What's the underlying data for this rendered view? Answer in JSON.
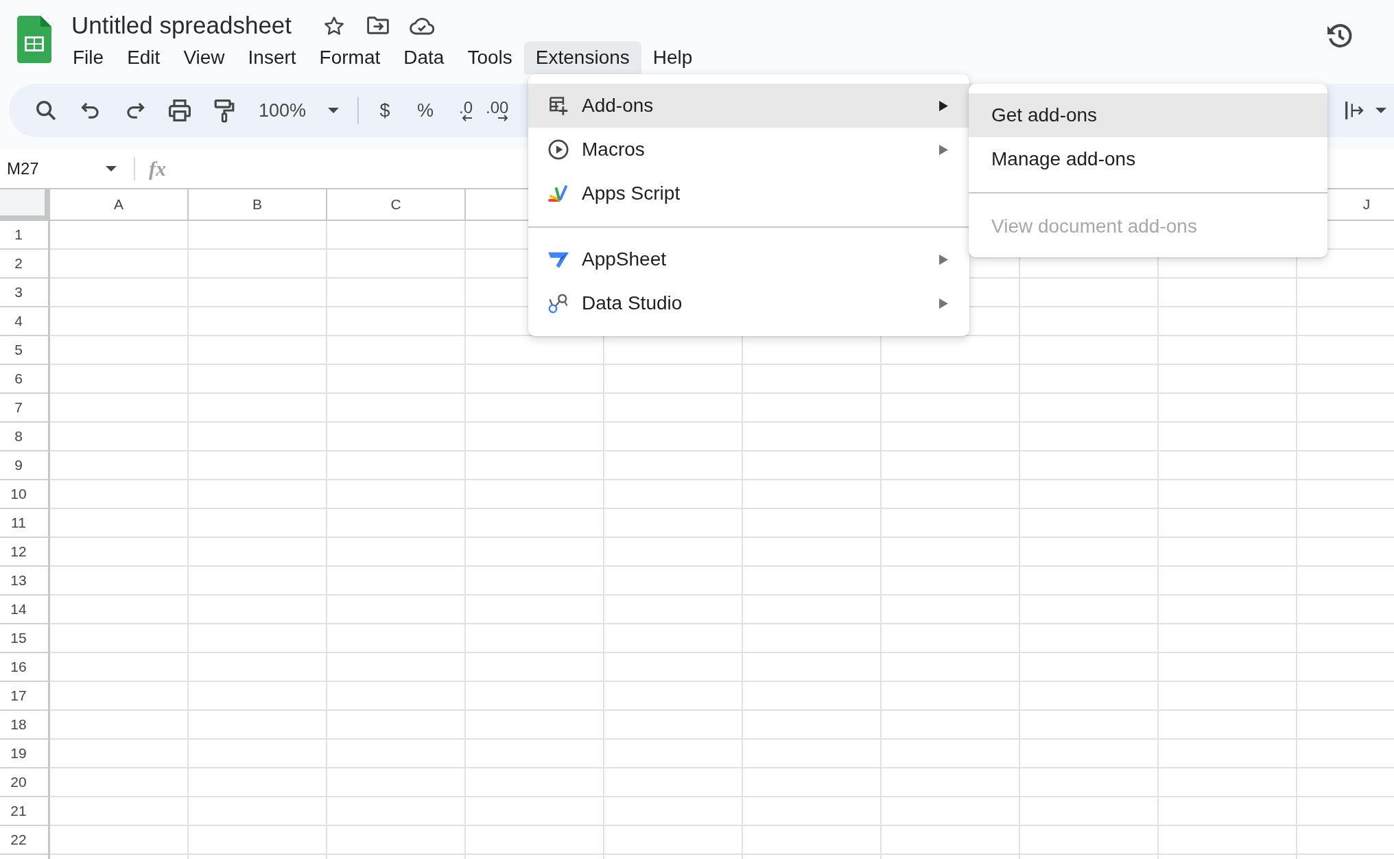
{
  "document": {
    "title": "Untitled spreadsheet"
  },
  "menu_bar": [
    {
      "label": "File",
      "selected": false
    },
    {
      "label": "Edit",
      "selected": false
    },
    {
      "label": "View",
      "selected": false
    },
    {
      "label": "Insert",
      "selected": false
    },
    {
      "label": "Format",
      "selected": false
    },
    {
      "label": "Data",
      "selected": false
    },
    {
      "label": "Tools",
      "selected": false
    },
    {
      "label": "Extensions",
      "selected": true
    },
    {
      "label": "Help",
      "selected": false
    }
  ],
  "toolbar": {
    "zoom": "100%",
    "currency": "$",
    "percent": "%",
    "decrease_decimal": ".0",
    "increase_decimal": ".00"
  },
  "formula_bar": {
    "cell_reference": "M27",
    "function_symbol": "fx"
  },
  "grid": {
    "columns": [
      "A",
      "B",
      "C"
    ],
    "last_column": "J",
    "rows": [
      "1",
      "2",
      "3",
      "4",
      "5",
      "6",
      "7",
      "8",
      "9",
      "10",
      "11",
      "12",
      "13",
      "14",
      "15",
      "16",
      "17",
      "18",
      "19",
      "20",
      "21",
      "22"
    ]
  },
  "extensions_menu": {
    "groups": [
      [
        {
          "label": "Add-ons",
          "selected": true,
          "submenu": true
        },
        {
          "label": "Macros",
          "selected": false,
          "submenu": true
        },
        {
          "label": "Apps Script",
          "selected": false,
          "submenu": false
        }
      ],
      [
        {
          "label": "AppSheet",
          "selected": false,
          "submenu": true
        },
        {
          "label": "Data Studio",
          "selected": false,
          "submenu": true
        }
      ]
    ]
  },
  "add_ons_submenu": {
    "groups": [
      [
        {
          "label": "Get add-ons",
          "selected": true,
          "disabled": false
        },
        {
          "label": "Manage add-ons",
          "selected": false,
          "disabled": false
        }
      ],
      [
        {
          "label": "View document add-ons",
          "selected": false,
          "disabled": true
        }
      ]
    ]
  }
}
